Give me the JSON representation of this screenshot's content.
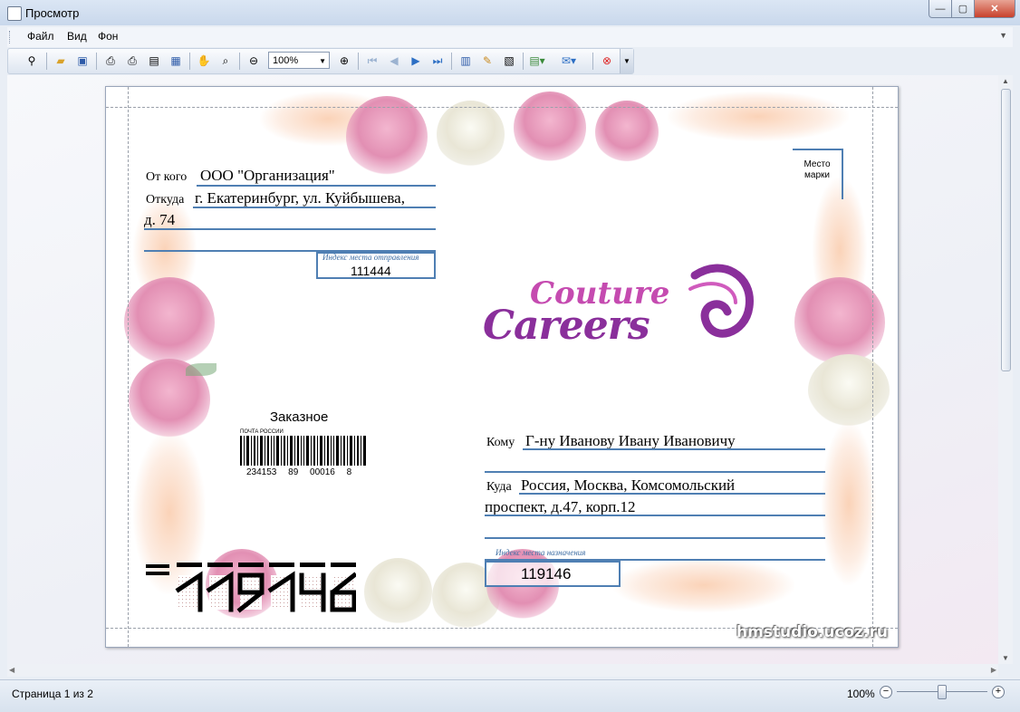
{
  "window": {
    "title": "Просмотр",
    "controls": {
      "minimize": "—",
      "maximize": "▢",
      "close": "✕"
    }
  },
  "menu": {
    "items": [
      {
        "label": "Файл"
      },
      {
        "label": "Вид"
      },
      {
        "label": "Фон"
      }
    ]
  },
  "toolbar": {
    "zoom_value": "100%",
    "icons": [
      "binoculars-icon",
      "open-folder-icon",
      "save-icon",
      "print-setup-icon",
      "print-icon",
      "print-preview-icon",
      "page-setup-icon",
      "hand-tool-icon",
      "zoom-tool-icon",
      "zoom-out-icon",
      "zoom-in-icon",
      "first-page-icon",
      "prev-page-icon",
      "next-page-icon",
      "last-page-icon",
      "multi-page-icon",
      "watermark-icon",
      "background-icon",
      "export-icon",
      "email-icon",
      "close-preview-icon"
    ]
  },
  "envelope": {
    "from_label": "От кого",
    "from_value": "ООО \"Организация\"",
    "origin_label": "Откуда",
    "origin_line1": "г. Екатеринбург, ул. Куйбышева,",
    "origin_line2": "д. 74",
    "sender_index_caption": "Индекс места отправления",
    "sender_index": "111444",
    "stamp_place": "Место марки",
    "logo_top": "Couture",
    "logo_bottom": "Careers",
    "registered": "Заказное",
    "barcode_caption": "ПОЧТА РОССИИ",
    "barcode_number": "234153 89 00016 8",
    "to_label": "Кому",
    "to_value": "Г-ну Иванову Ивану Ивановичу",
    "dest_label": "Куда",
    "dest_line1": "Россия, Москва, Комсомольский",
    "dest_line2": "проспект, д.47, корп.12",
    "dest_index_caption": "Индекс места назначения",
    "dest_index": "119146",
    "index_digits": "119146",
    "watermark": "hmstudio.ucoz.ru"
  },
  "status": {
    "page_info": "Страница 1 из 2",
    "zoom": "100%",
    "zoom_level": 0.5
  }
}
